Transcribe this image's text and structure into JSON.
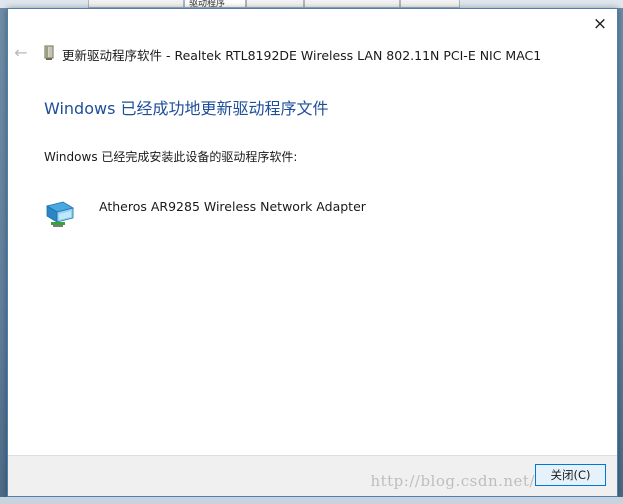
{
  "background_window": {
    "tabs": [
      "",
      "驱动程序",
      "",
      "",
      ""
    ]
  },
  "dialog": {
    "close_icon": "×",
    "back_icon": "←",
    "title": "更新驱动程序软件 - Realtek RTL8192DE Wireless LAN 802.11N PCI-E NIC MAC1",
    "heading": "Windows 已经成功地更新驱动程序文件",
    "subtext": "Windows 已经完成安装此设备的驱动程序软件:",
    "device_name": "Atheros AR9285 Wireless Network Adapter",
    "close_button_label": "关闭(C)",
    "watermark": "http://blog.csdn.net/"
  },
  "colors": {
    "heading": "#1f4e99",
    "accent_border": "#0078d7",
    "button_bg": "#e5f1fb"
  }
}
